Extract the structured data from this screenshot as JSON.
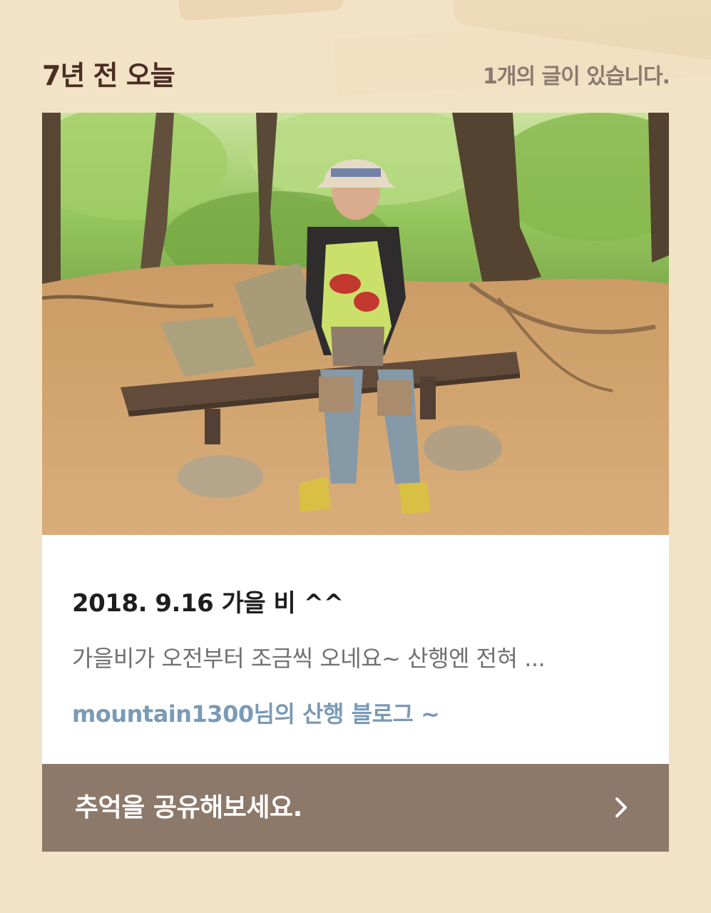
{
  "header": {
    "title": "7년 전 오늘",
    "post_count": "1개의 글이 있습니다."
  },
  "post": {
    "photo_icon": "hiker-on-bench-photo",
    "title": "2018. 9.16 가을 비 ^^",
    "excerpt": "가을비가 오전부터 조금씩 오네요~ 산행엔 전혀 ...",
    "blog_name": "mountain1300님의 산행 블로그 ~"
  },
  "share": {
    "label": "추억을 공유해보세요.",
    "icon": "chevron-right-icon"
  },
  "colors": {
    "background": "#f3e3c6",
    "title_text": "#4b2d24",
    "blog_link": "#7a9ab5",
    "share_bar": "#8d796a"
  }
}
